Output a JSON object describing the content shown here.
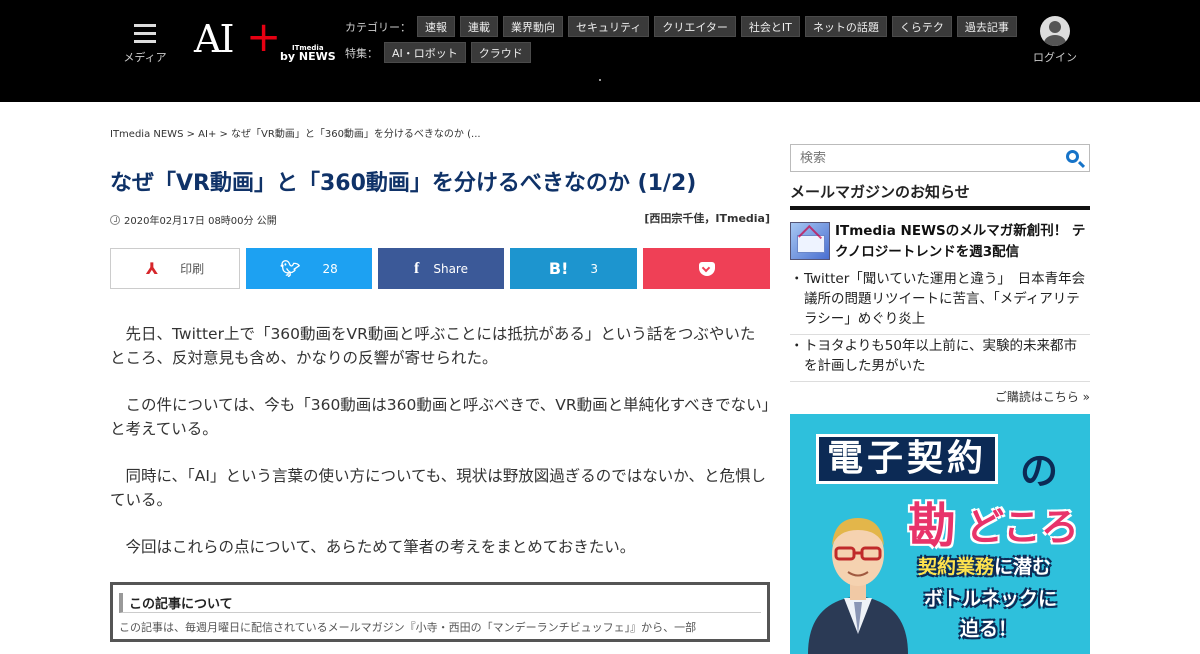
{
  "header": {
    "menu_label": "メディア",
    "logo": {
      "ai": "AI",
      "plus": "+",
      "itmedia": "ITmedia",
      "by": "by NEWS"
    },
    "category_label": "カテゴリー：",
    "categories": [
      "速報",
      "連載",
      "業界動向",
      "セキュリティ",
      "クリエイター",
      "社会とIT",
      "ネットの話題",
      "くらテク",
      "過去記事"
    ],
    "feature_label": "特集：",
    "features": [
      "AI・ロボット",
      "クラウド"
    ],
    "login_label": "ログイン"
  },
  "breadcrumb": "ITmedia NEWS > AI+ > なぜ「VR動画」と「360動画」を分けるべきなのか (...",
  "article": {
    "title": "なぜ「VR動画」と「360動画」を分けるべきなのか (1/2)",
    "date": "2020年02月17日 08時00分 公開",
    "author": "[西田宗千佳，ITmedia]",
    "share": {
      "print_label": "印刷",
      "twitter_count": "28",
      "facebook_label": "Share",
      "hatena_count": "3"
    },
    "paragraphs": [
      "先日、Twitter上で「360動画をVR動画と呼ぶことには抵抗がある」という話をつぶやいたところ、反対意見も含め、かなりの反響が寄せられた。",
      "この件については、今も「360動画は360動画と呼ぶべきで、VR動画と単純化すべきでない」と考えている。",
      "同時に、「AI」という言葉の使い方についても、現状は野放図過ぎるのではないか、と危惧している。",
      "今回はこれらの点について、あらためて筆者の考えをまとめておきたい。"
    ],
    "about_heading": "この記事について",
    "about_text": "この記事は、毎週月曜日に配信されているメールマガジン『小寺・西田の「マンデーランチビュッフェ」』から、一部"
  },
  "sidebar": {
    "search_placeholder": "検索",
    "newsletter_heading": "メールマガジンのお知らせ",
    "newsletter_lead": "ITmedia NEWSのメルマガ新創刊！ テクノロジートレンドを週3配信",
    "items": [
      "Twitter「聞いていた運用と違う」　日本青年会議所の問題リツイートに苦言、「メディアリテラシー」めぐり炎上",
      "トヨタよりも50年以上前に、実験的未来都市を計画した男がいた"
    ],
    "more_link": "ご購読はこちら »",
    "ad": {
      "line1": "電子契約",
      "no": "の",
      "kan": "勘",
      "dokoro": "どころ",
      "line3a": "契約業務",
      "line3b": "に潜む",
      "line4": "ボトルネックに",
      "line5": "迫る！"
    }
  },
  "colors": {
    "title": "#0f3268",
    "twitter": "#1da1f2",
    "facebook": "#3b5998",
    "hatena": "#1d95cf",
    "pocket": "#ef4056",
    "ad_bg": "#2ec0dc",
    "accent_red": "#e60012"
  }
}
